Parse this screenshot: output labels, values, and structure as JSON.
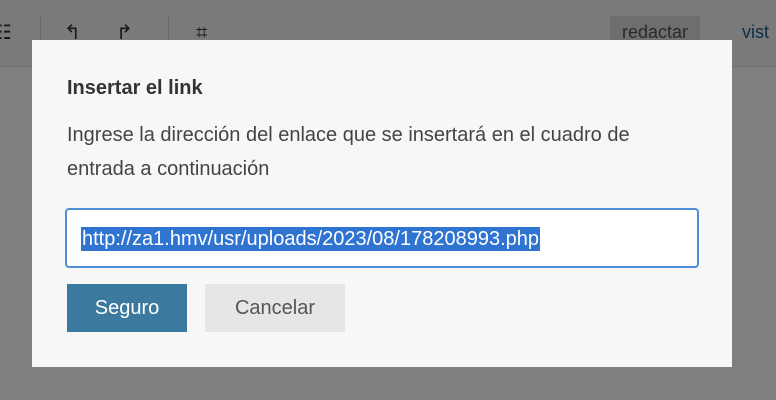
{
  "toolbar": {
    "mode_edit_label": "redactar",
    "mode_view_label": "vist",
    "icons": [
      "list-icon",
      "undo-icon",
      "redo-icon",
      "fullscreen-icon"
    ]
  },
  "dialog": {
    "title": "Insertar el link",
    "description": "Ingrese la dirección del enlace que se insertará en el cuadro de entrada a continuación",
    "input_value": "http://za1.hmv/usr/uploads/2023/08/178208993.php",
    "confirm_label": "Seguro",
    "cancel_label": "Cancelar"
  },
  "colors": {
    "primary_button": "#3b7a9e",
    "secondary_button": "#e6e6e4",
    "input_focus_border": "#4a8fd8",
    "selection_highlight": "#2f74d0"
  }
}
